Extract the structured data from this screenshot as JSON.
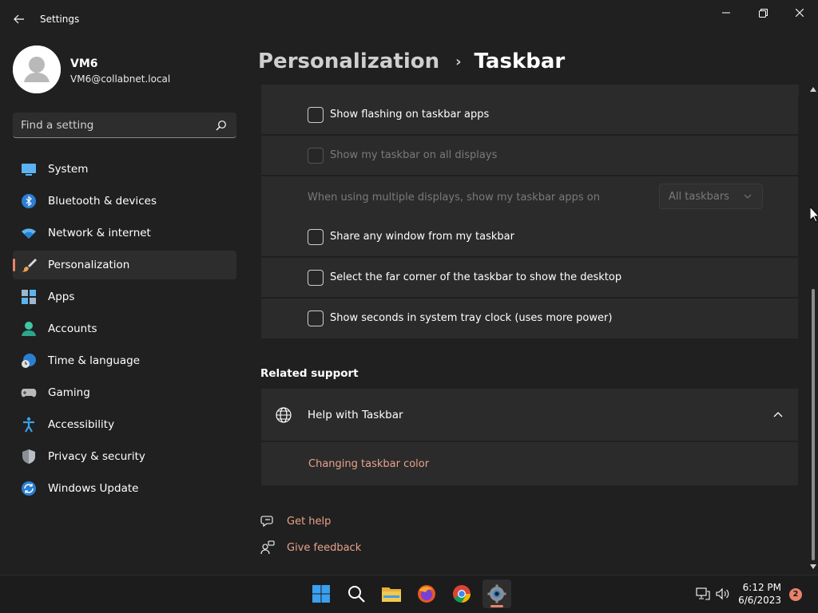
{
  "window": {
    "title": "Settings"
  },
  "profile": {
    "name": "VM6",
    "email": "VM6@collabnet.local"
  },
  "search": {
    "placeholder": "Find a setting"
  },
  "sidebar": {
    "items": [
      {
        "label": "System",
        "icon": "system-icon"
      },
      {
        "label": "Bluetooth & devices",
        "icon": "bluetooth-icon"
      },
      {
        "label": "Network & internet",
        "icon": "wifi-icon"
      },
      {
        "label": "Personalization",
        "icon": "brush-icon",
        "active": true
      },
      {
        "label": "Apps",
        "icon": "apps-icon"
      },
      {
        "label": "Accounts",
        "icon": "account-icon"
      },
      {
        "label": "Time & language",
        "icon": "clock-globe-icon"
      },
      {
        "label": "Gaming",
        "icon": "gamepad-icon"
      },
      {
        "label": "Accessibility",
        "icon": "accessibility-icon"
      },
      {
        "label": "Privacy & security",
        "icon": "shield-icon"
      },
      {
        "label": "Windows Update",
        "icon": "update-icon"
      }
    ]
  },
  "header": {
    "parent": "Personalization",
    "current": "Taskbar"
  },
  "settings": {
    "rows": [
      {
        "label": "Show flashing on taskbar apps",
        "checked": false,
        "disabled": false
      },
      {
        "label": "Show my taskbar on all displays",
        "checked": false,
        "disabled": true
      },
      {
        "label": "When using multiple displays, show my taskbar apps on",
        "disabled": true,
        "dropdown": "All taskbars"
      },
      {
        "label": "Share any window from my taskbar",
        "checked": false,
        "disabled": false
      },
      {
        "label": "Select the far corner of the taskbar to show the desktop",
        "checked": false,
        "disabled": false
      },
      {
        "label": "Show seconds in system tray clock (uses more power)",
        "checked": false,
        "disabled": false
      }
    ]
  },
  "related_support": {
    "title": "Related support",
    "help_title": "Help with Taskbar",
    "help_link": "Changing taskbar color"
  },
  "footer": {
    "get_help": "Get help",
    "give_feedback": "Give feedback"
  },
  "taskbar": {
    "apps": [
      "start-icon",
      "search-icon",
      "file-explorer-icon",
      "firefox-icon",
      "chrome-icon",
      "settings-icon"
    ],
    "clock_time": "6:12 PM",
    "clock_date": "6/6/2023",
    "notification_count": "2"
  },
  "colors": {
    "background": "#202020",
    "card": "#2b2b2b",
    "accent": "#e8836a",
    "link": "#e8a389"
  }
}
